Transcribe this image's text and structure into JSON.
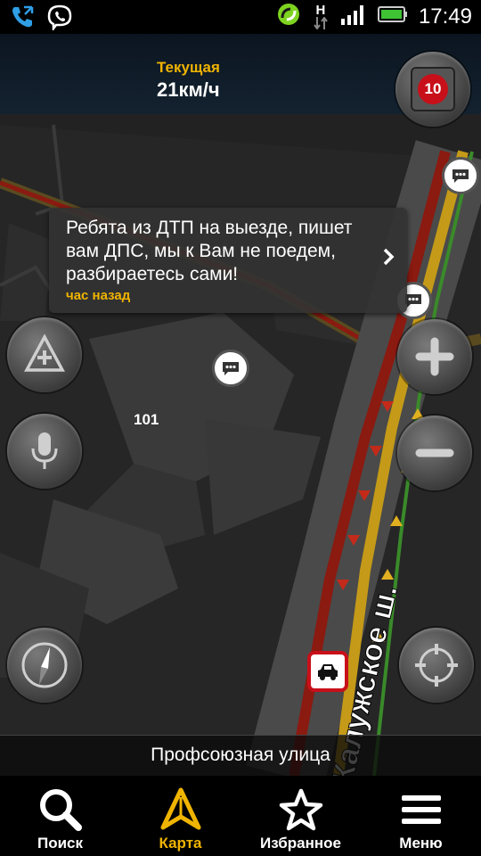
{
  "status_bar": {
    "time": "17:49",
    "network_letter": "H"
  },
  "speed": {
    "label": "Текущая",
    "value": "21км/ч"
  },
  "speed_camera": {
    "value": "10"
  },
  "message": {
    "text": "Ребята из ДТП на выезде, пишет вам ДПС, мы к Вам не поедем, разбираетесь сами!",
    "time": "час назад"
  },
  "map": {
    "house_number": "101",
    "road_name": "Калужское ш."
  },
  "street": {
    "name": "Профсоюзная улица"
  },
  "nav": {
    "items": [
      {
        "label": "Поиск",
        "icon": "search-icon"
      },
      {
        "label": "Карта",
        "icon": "map-icon"
      },
      {
        "label": "Избранное",
        "icon": "star-icon"
      },
      {
        "label": "Меню",
        "icon": "menu-icon"
      }
    ],
    "active": "Карта"
  },
  "colors": {
    "accent": "#f0b400",
    "traffic_red": "#8b1a10",
    "traffic_yellow": "#c49a18"
  }
}
